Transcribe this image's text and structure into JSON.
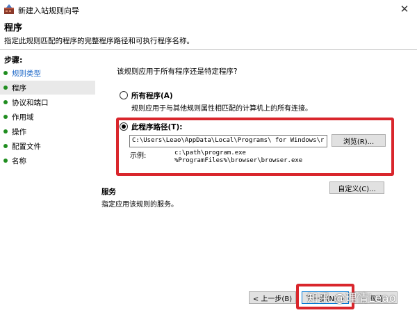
{
  "window": {
    "title": "新建入站规则向导",
    "close_glyph": "✕"
  },
  "header": {
    "title": "程序",
    "description": "指定此规则匹配的程序的完整程序路径和可执行程序名称。"
  },
  "steps": {
    "title": "步骤:",
    "items": [
      {
        "label": "规则类型",
        "state": "done"
      },
      {
        "label": "程序",
        "state": "current"
      },
      {
        "label": "协议和端口",
        "state": "pending"
      },
      {
        "label": "作用域",
        "state": "pending"
      },
      {
        "label": "操作",
        "state": "pending"
      },
      {
        "label": "配置文件",
        "state": "pending"
      },
      {
        "label": "名称",
        "state": "pending"
      }
    ]
  },
  "main": {
    "question": "该规则应用于所有程序还是特定程序?",
    "all_programs": {
      "label": "所有程序(A)",
      "description": "规则应用于与其他规则属性相匹配的计算机上的所有连接。",
      "selected": false
    },
    "this_program": {
      "label": "此程序路径(T):",
      "value": "C:\\Users\\Leao\\AppData\\Local\\Programs\\        for Windows\\r",
      "selected": true,
      "browse_label": "浏览(R)...",
      "example_label": "示例:",
      "example_line1": "c:\\path\\program.exe",
      "example_line2": "%ProgramFiles%\\browser\\browser.exe"
    },
    "services": {
      "title": "服务",
      "description": "指定应用该规则的服务。",
      "customize_label": "自定义(C)..."
    }
  },
  "footer": {
    "back_label": "< 上一步(B)",
    "next_label": "下一步(N) >",
    "cancel_label": "取消"
  },
  "watermark": "知乎 @理情Leao",
  "colors": {
    "highlight_red": "#d9262c",
    "done_step_blue": "#1a66c7",
    "step_dot_green": "#1f8d1f"
  }
}
